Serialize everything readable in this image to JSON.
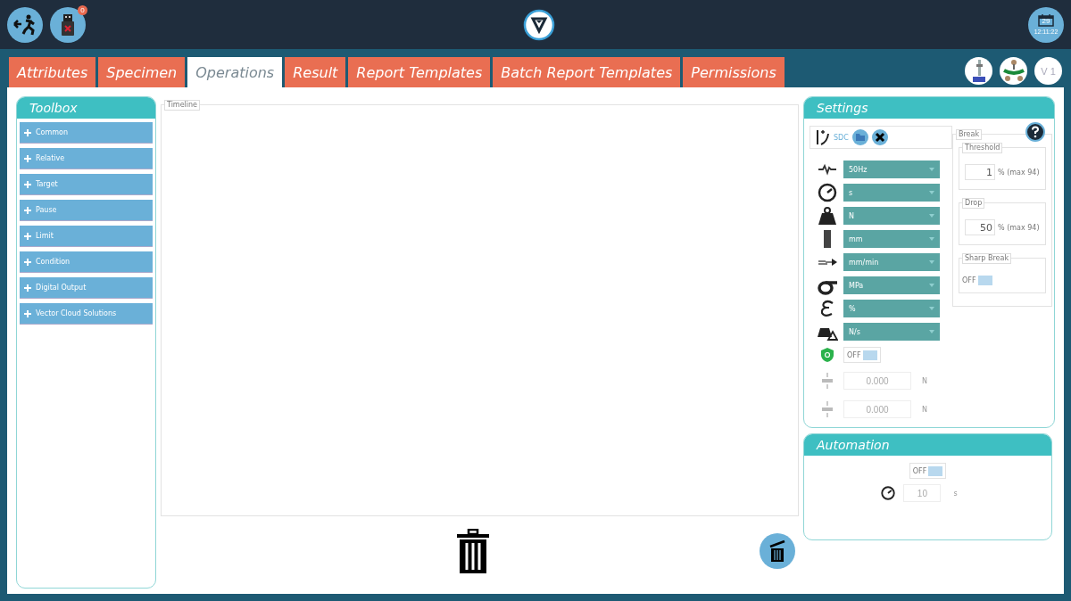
{
  "header": {
    "usb_badge": "0",
    "date": "29",
    "time": "12:11:22"
  },
  "tabs": [
    {
      "label": "Attributes",
      "selected": false
    },
    {
      "label": "Specimen",
      "selected": false
    },
    {
      "label": "Operations",
      "selected": true
    },
    {
      "label": "Result",
      "selected": false
    },
    {
      "label": "Report Templates",
      "selected": false
    },
    {
      "label": "Batch Report Templates",
      "selected": false
    },
    {
      "label": "Permissions",
      "selected": false
    }
  ],
  "version": "V 1",
  "toolbox": {
    "title": "Toolbox",
    "items": [
      {
        "label": "Common"
      },
      {
        "label": "Relative"
      },
      {
        "label": "Target"
      },
      {
        "label": "Pause"
      },
      {
        "label": "Limit"
      },
      {
        "label": "Condition"
      },
      {
        "label": "Digital Output"
      },
      {
        "label": "Vector Cloud Solutions"
      }
    ]
  },
  "timeline": {
    "label": "Timeline"
  },
  "settings": {
    "title": "Settings",
    "sensor": "SDC",
    "selects": [
      {
        "kind": "frequency",
        "value": "50Hz"
      },
      {
        "kind": "time",
        "value": "s"
      },
      {
        "kind": "force",
        "value": "N"
      },
      {
        "kind": "length",
        "value": "mm"
      },
      {
        "kind": "speed",
        "value": "mm/min"
      },
      {
        "kind": "stress",
        "value": "MPa"
      },
      {
        "kind": "strain",
        "value": "%"
      },
      {
        "kind": "rate",
        "value": "N/s"
      }
    ],
    "protection": {
      "on": false,
      "label": "OFF"
    },
    "limits": [
      {
        "value": "0.000",
        "unit": "N"
      },
      {
        "value": "0.000",
        "unit": "N"
      }
    ],
    "break": {
      "label": "Break",
      "threshold": {
        "label": "Threshold",
        "value": "1",
        "suffix": "% (max 94)"
      },
      "drop": {
        "label": "Drop",
        "value": "50",
        "suffix": "% (max 94)"
      },
      "sharp_break": {
        "label": "Sharp Break",
        "on": false,
        "state": "OFF"
      }
    }
  },
  "automation": {
    "title": "Automation",
    "toggle": {
      "on": false,
      "label": "OFF"
    },
    "delay": {
      "value": "10",
      "unit": "s"
    }
  }
}
